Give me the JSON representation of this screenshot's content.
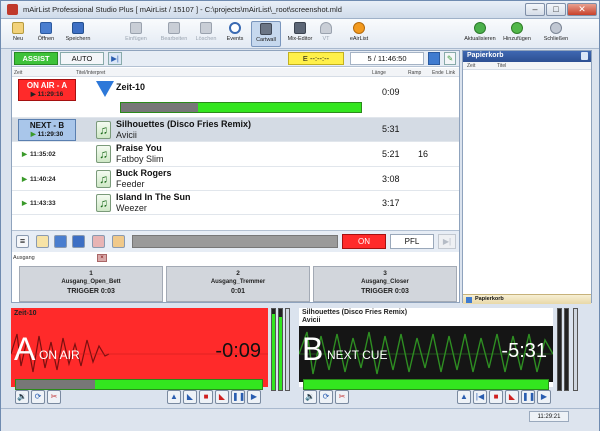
{
  "window": {
    "title": "mAirList Professional Studio Plus [ mAirList / 15107 ] - C:\\projects\\mAirList\\_root\\screenshot.mld"
  },
  "toolbar": {
    "items": [
      {
        "label": "Neu",
        "icon": "new-icon",
        "enabled": true
      },
      {
        "label": "Öffnen",
        "icon": "open-icon",
        "enabled": true
      },
      {
        "label": "Speichern",
        "icon": "save-icon",
        "enabled": true
      },
      {
        "label": "Einfügen",
        "icon": "insert-icon",
        "enabled": false
      },
      {
        "label": "Bearbeiten",
        "icon": "edit-icon",
        "enabled": false
      },
      {
        "label": "Löschen",
        "icon": "delete-icon",
        "enabled": false
      },
      {
        "label": "Events",
        "icon": "clock-icon",
        "enabled": true
      },
      {
        "label": "Cartwall",
        "icon": "cartwall-icon",
        "enabled": true,
        "active": true
      },
      {
        "label": "Mix-Editor",
        "icon": "mix-icon",
        "enabled": true
      },
      {
        "label": "VT",
        "icon": "mic-icon",
        "enabled": false
      },
      {
        "label": "eAirList",
        "icon": "eairlist-icon",
        "enabled": true
      }
    ],
    "right_items": [
      {
        "label": "Aktualisieren",
        "icon": "refresh-icon"
      },
      {
        "label": "Hinzufügen",
        "icon": "add-icon"
      },
      {
        "label": "Schließen",
        "icon": "close-gear-icon"
      }
    ]
  },
  "controls": {
    "assist": "ASSIST",
    "auto": "AUTO",
    "e_label": "E --:--:--",
    "position": "5 / 11:46:50"
  },
  "playlist": {
    "columns": {
      "time": "Zeit",
      "title": "Titel/Interpret",
      "length": "Länge",
      "ramp": "Ramp",
      "end": "Ende",
      "link": "Link"
    },
    "onair": {
      "label": "ON AIR - A",
      "time": "11:29:16",
      "title": "Zeit-10",
      "length": "0:09"
    },
    "next": {
      "label": "NEXT - B",
      "time": "11:29:30",
      "title": "Silhouettes (Disco Fries Remix)",
      "artist": "Avicii",
      "length": "5:31"
    },
    "items": [
      {
        "time": "11:35:02",
        "title": "Praise You",
        "artist": "Fatboy Slim",
        "length": "5:21",
        "ramp": "16"
      },
      {
        "time": "11:40:24",
        "title": "Buck Rogers",
        "artist": "Feeder",
        "length": "3:08",
        "ramp": ""
      },
      {
        "time": "11:43:33",
        "title": "Island In The Sun",
        "artist": "Weezer",
        "length": "3:17",
        "ramp": ""
      }
    ]
  },
  "bottombar": {
    "on": "ON",
    "pfl": "PFL"
  },
  "cartwall": {
    "output_label": "Ausgang",
    "carts": [
      {
        "number": "1",
        "name": "Ausgang_Open_Bett",
        "info": "TRIGGER 0:03"
      },
      {
        "number": "2",
        "name": "Ausgang_Tremmer",
        "info": "0:01"
      },
      {
        "number": "3",
        "name": "Ausgang_Closer",
        "info": "TRIGGER 0:03"
      }
    ]
  },
  "papierkorb": {
    "title": "Papierkorb",
    "columns": {
      "time": "Zeit",
      "title": "Titel"
    },
    "footer": "Papierkorb"
  },
  "players": {
    "a": {
      "header": "Zeit-10",
      "letter": "A",
      "status": "ON AIR",
      "time": "-0:09"
    },
    "b": {
      "header": "Silhouettes (Disco Fries Remix)",
      "sub": "Avicii",
      "letter": "B",
      "status": "NEXT CUE",
      "time": "-5:31"
    }
  },
  "status": {
    "clock": "11:29:21"
  },
  "colors": {
    "onair_red": "#ff2a2a",
    "next_blue": "#a9c6ea",
    "progress_green": "#33e61f",
    "assist_green": "#3ec23a",
    "e_yellow": "#fff04a"
  }
}
